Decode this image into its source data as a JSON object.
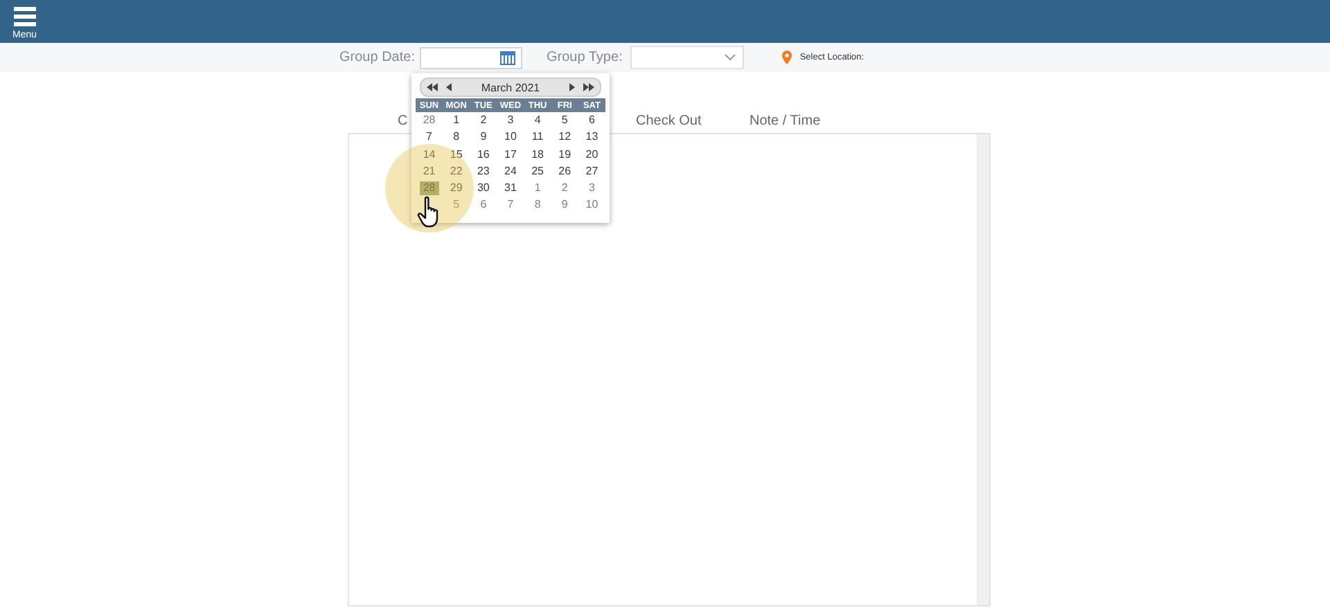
{
  "header": {
    "menu_label": "Menu"
  },
  "filters": {
    "group_date_label": "Group Date:",
    "group_type_label": "Group Type:",
    "location_label": "Select Location:"
  },
  "calendar": {
    "title": "March 2021",
    "weekdays": [
      "SUN",
      "MON",
      "TUE",
      "WED",
      "THU",
      "FRI",
      "SAT"
    ],
    "weeks": [
      [
        {
          "day": "28",
          "other_month": true,
          "selected": false
        },
        {
          "day": "1",
          "other_month": false,
          "selected": false
        },
        {
          "day": "2",
          "other_month": false,
          "selected": false
        },
        {
          "day": "3",
          "other_month": false,
          "selected": false
        },
        {
          "day": "4",
          "other_month": false,
          "selected": false
        },
        {
          "day": "5",
          "other_month": false,
          "selected": false
        },
        {
          "day": "6",
          "other_month": false,
          "selected": false
        }
      ],
      [
        {
          "day": "7",
          "other_month": false,
          "selected": false
        },
        {
          "day": "8",
          "other_month": false,
          "selected": false
        },
        {
          "day": "9",
          "other_month": false,
          "selected": false
        },
        {
          "day": "10",
          "other_month": false,
          "selected": false
        },
        {
          "day": "11",
          "other_month": false,
          "selected": false
        },
        {
          "day": "12",
          "other_month": false,
          "selected": false
        },
        {
          "day": "13",
          "other_month": false,
          "selected": false
        }
      ],
      [
        {
          "day": "14",
          "other_month": false,
          "selected": false
        },
        {
          "day": "15",
          "other_month": false,
          "selected": false
        },
        {
          "day": "16",
          "other_month": false,
          "selected": false
        },
        {
          "day": "17",
          "other_month": false,
          "selected": false
        },
        {
          "day": "18",
          "other_month": false,
          "selected": false
        },
        {
          "day": "19",
          "other_month": false,
          "selected": false
        },
        {
          "day": "20",
          "other_month": false,
          "selected": false
        }
      ],
      [
        {
          "day": "21",
          "other_month": false,
          "selected": false
        },
        {
          "day": "22",
          "other_month": false,
          "selected": false
        },
        {
          "day": "23",
          "other_month": false,
          "selected": false
        },
        {
          "day": "24",
          "other_month": false,
          "selected": false
        },
        {
          "day": "25",
          "other_month": false,
          "selected": false
        },
        {
          "day": "26",
          "other_month": false,
          "selected": false
        },
        {
          "day": "27",
          "other_month": false,
          "selected": false
        }
      ],
      [
        {
          "day": "28",
          "other_month": false,
          "selected": true
        },
        {
          "day": "29",
          "other_month": false,
          "selected": false
        },
        {
          "day": "30",
          "other_month": false,
          "selected": false
        },
        {
          "day": "31",
          "other_month": false,
          "selected": false
        },
        {
          "day": "1",
          "other_month": true,
          "selected": false
        },
        {
          "day": "2",
          "other_month": true,
          "selected": false
        },
        {
          "day": "3",
          "other_month": true,
          "selected": false
        }
      ],
      [
        {
          "day": "5",
          "other_month": true,
          "selected": false
        },
        {
          "day": "6",
          "other_month": true,
          "selected": false
        },
        {
          "day": "7",
          "other_month": true,
          "selected": false
        },
        {
          "day": "8",
          "other_month": true,
          "selected": false
        },
        {
          "day": "9",
          "other_month": true,
          "selected": false
        },
        {
          "day": "10",
          "other_month": true,
          "selected": false
        }
      ]
    ]
  },
  "table": {
    "columns": [
      "C",
      "Check Out",
      "Note / Time"
    ]
  }
}
